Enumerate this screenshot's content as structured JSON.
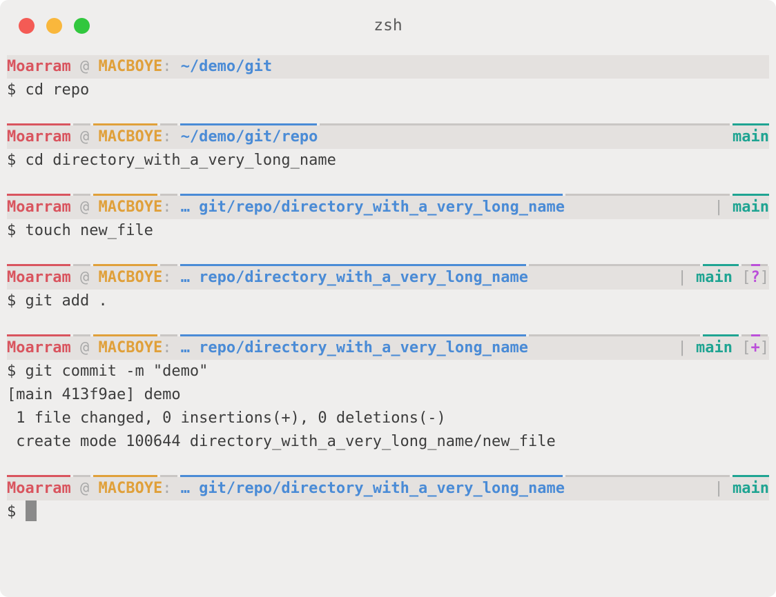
{
  "window": {
    "title": "zsh"
  },
  "prompt": {
    "user": "Moarram",
    "at": "@",
    "host": "MACBOYE",
    "colon": ":",
    "separator": "|",
    "ellipsis": "…"
  },
  "blocks": [
    {
      "path": "~/demo/git",
      "branch": "",
      "status_open": "",
      "status": "",
      "status_close": "",
      "command": "cd repo",
      "output": []
    },
    {
      "path": "~/demo/git/repo",
      "branch": "main",
      "status_open": "",
      "status": "",
      "status_close": "",
      "command": "cd directory_with_a_very_long_name",
      "output": []
    },
    {
      "path": "… git/repo/directory_with_a_very_long_name",
      "branch": "main",
      "status_open": "",
      "status": "",
      "status_close": "",
      "command": "touch new_file",
      "output": []
    },
    {
      "path": "… repo/directory_with_a_very_long_name",
      "branch": "main",
      "status_open": "[",
      "status": "?",
      "status_close": "]",
      "command": "git add .",
      "output": []
    },
    {
      "path": "… repo/directory_with_a_very_long_name",
      "branch": "main",
      "status_open": "[",
      "status": "+",
      "status_close": "]",
      "command": "git commit -m \"demo\"",
      "output": [
        "[main 413f9ae] demo",
        " 1 file changed, 0 insertions(+), 0 deletions(-)",
        " create mode 100644 directory_with_a_very_long_name/new_file"
      ]
    },
    {
      "path": "… git/repo/directory_with_a_very_long_name",
      "branch": "main",
      "status_open": "",
      "status": "",
      "status_close": "",
      "command": "",
      "output": []
    }
  ],
  "shell": {
    "dollar": "$"
  },
  "colors": {
    "user": "#d9545e",
    "host": "#e0a03a",
    "path": "#4a8bd6",
    "branch": "#1fa492",
    "status": "#bb4fd9",
    "separator": "#a9a9a9",
    "background": "#efeeed",
    "prompt_bar": "#e4e1df"
  }
}
